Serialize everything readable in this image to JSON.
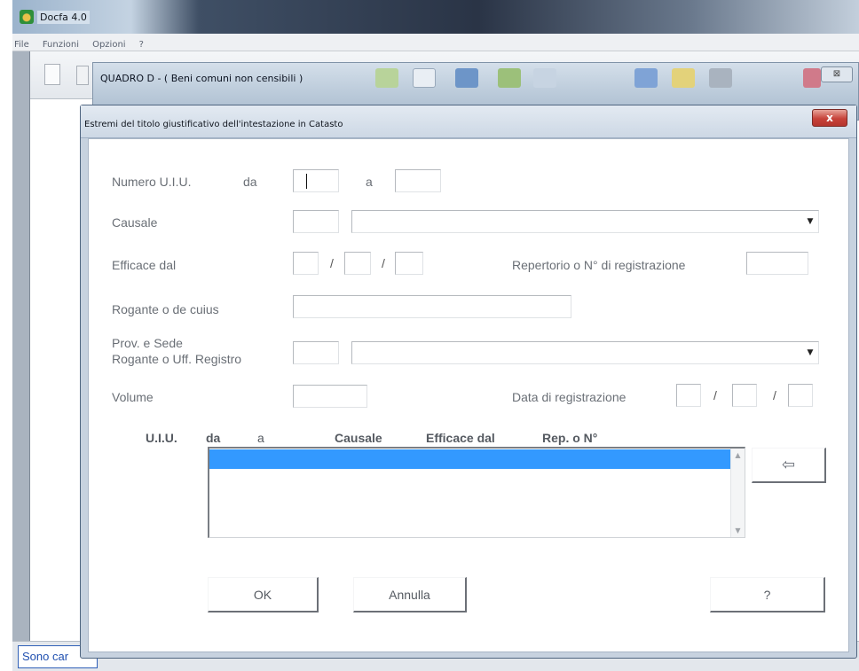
{
  "app": {
    "title": "Docfa 4.0",
    "menu": [
      "File",
      "Funzioni",
      "Opzioni",
      "?"
    ],
    "status_text": "Sono car"
  },
  "quadro": {
    "title": "QUADRO D  -  ( Beni comuni non censibili )",
    "close_glyph": "⊠"
  },
  "dialog": {
    "title": "Estremi del titolo giustificativo dell'intestazione in Catasto",
    "close_glyph": "x",
    "labels": {
      "numero_uiu": "Numero U.I.U.",
      "da": "da",
      "a": "a",
      "causale": "Causale",
      "efficace_dal": "Efficace dal",
      "repertorio": "Repertorio o N° di registrazione",
      "rogante": "Rogante o de cuius",
      "prov_sede_1": "Prov. e Sede",
      "prov_sede_2": "Rogante o Uff. Registro",
      "volume": "Volume",
      "data_registrazione": "Data di registrazione"
    },
    "date_separator": "/",
    "fields": {
      "numero_da": "",
      "numero_a": "",
      "causale_code": "",
      "causale_desc": "",
      "efficace_gg": "",
      "efficace_mm": "",
      "efficace_aa": "",
      "repertorio": "",
      "rogante": "",
      "prov_code": "",
      "prov_desc": "",
      "volume": "",
      "data_gg": "",
      "data_mm": "",
      "data_aa": ""
    },
    "grid": {
      "headers": [
        "U.I.U.",
        "da",
        "a",
        "Causale",
        "Efficace dal",
        "Rep. o N°"
      ],
      "rows": []
    },
    "buttons": {
      "ok": "OK",
      "annulla": "Annulla",
      "help": "?",
      "insert_icon": "refresh-arrow-icon"
    }
  }
}
